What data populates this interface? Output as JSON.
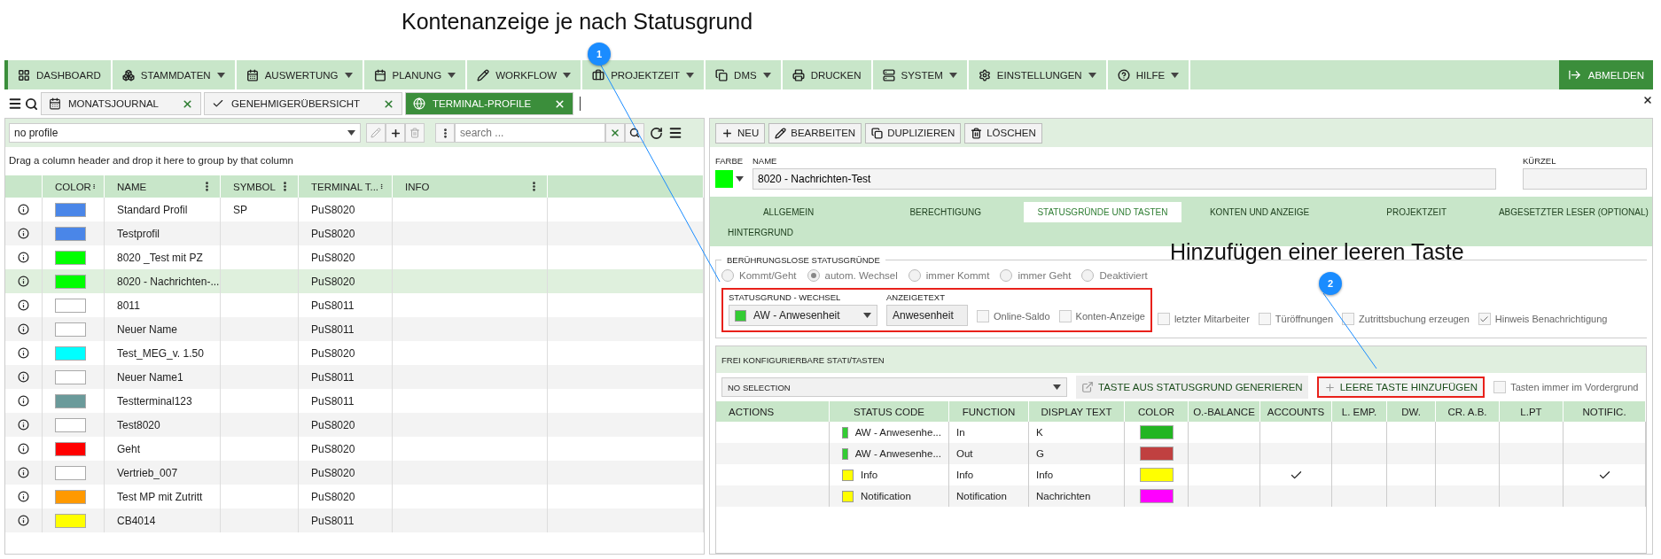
{
  "annotations": [
    {
      "text": "Kontenanzeige je nach Statusgrund"
    },
    {
      "text": "Hinzufügen einer leeren Taste"
    }
  ],
  "callouts": [
    "1",
    "2"
  ],
  "menu": [
    {
      "label": "DASHBOARD",
      "dropdown": false
    },
    {
      "label": "STAMMDATEN",
      "dropdown": true
    },
    {
      "label": "AUSWERTUNG",
      "dropdown": true
    },
    {
      "label": "PLANUNG",
      "dropdown": true
    },
    {
      "label": "WORKFLOW",
      "dropdown": true
    },
    {
      "label": "PROJEKTZEIT",
      "dropdown": true
    },
    {
      "label": "DMS",
      "dropdown": true
    },
    {
      "label": "DRUCKEN",
      "dropdown": false
    },
    {
      "label": "SYSTEM",
      "dropdown": true
    },
    {
      "label": "EINSTELLUNGEN",
      "dropdown": true
    },
    {
      "label": "HILFE",
      "dropdown": true
    }
  ],
  "logout": "ABMELDEN",
  "tabs": [
    {
      "label": "MONATSJOURNAL",
      "selected": false
    },
    {
      "label": "GENEHMIGERÜBERSICHT",
      "selected": false
    },
    {
      "label": "TERMINAL-PROFILE",
      "selected": true
    }
  ],
  "left": {
    "profile": "no profile",
    "search_placeholder": "search ...",
    "group_hint": "Drag a column header and drop it here to group by that column",
    "columns": [
      "COLOR",
      "NAME",
      "SYMBOL",
      "TERMINAL T...",
      "INFO"
    ],
    "rows": [
      {
        "color": "#4a86e8",
        "name": "Standard Profil",
        "symbol": "SP",
        "terminal": "PuS8020",
        "selected": false
      },
      {
        "color": "#4a86e8",
        "name": "Testprofil",
        "terminal": "PuS8020",
        "selected": false
      },
      {
        "color": "#00ff00",
        "name": "8020 _Test mit PZ",
        "terminal": "PuS8020",
        "selected": false
      },
      {
        "color": "#00ff00",
        "name": "8020 - Nachrichten-...",
        "terminal": "PuS8020",
        "selected": true
      },
      {
        "color": "#ffffff",
        "name": "8011",
        "terminal": "PuS8011",
        "selected": false
      },
      {
        "color": "#ffffff",
        "name": "Neuer Name",
        "terminal": "PuS8011",
        "selected": false
      },
      {
        "color": "#00ffff",
        "name": "Test_MEG_v. 1.50",
        "terminal": "PuS8020",
        "selected": false
      },
      {
        "color": "#ffffff",
        "name": "Neuer Name1",
        "terminal": "PuS8011",
        "selected": false
      },
      {
        "color": "#6a9a9a",
        "name": "Testterminal123",
        "terminal": "PuS8011",
        "selected": false
      },
      {
        "color": "#ffffff",
        "name": "Test8020",
        "terminal": "PuS8020",
        "selected": false
      },
      {
        "color": "#ff0000",
        "name": "Geht",
        "terminal": "PuS8020",
        "selected": false
      },
      {
        "color": "#ffffff",
        "name": "Vertrieb_007",
        "terminal": "PuS8020",
        "selected": false
      },
      {
        "color": "#ff9900",
        "name": "Test MP mit Zutritt",
        "terminal": "PuS8020",
        "selected": false
      },
      {
        "color": "#ffff00",
        "name": "CB4014",
        "terminal": "PuS8011",
        "selected": false
      }
    ]
  },
  "right": {
    "toolbar": [
      "NEU",
      "BEARBEITEN",
      "DUPLIZIEREN",
      "LÖSCHEN"
    ],
    "color_label": "FARBE",
    "color": "#00ff00",
    "name_label": "NAME",
    "name": "8020 - Nachrichten-Test",
    "short_label": "KÜRZEL",
    "detail_tabs": [
      {
        "label": "ALLGEMEIN",
        "selected": false
      },
      {
        "label": "BERECHTIGUNG",
        "selected": false
      },
      {
        "label": "STATUSGRÜNDE UND TASTEN",
        "selected": true
      },
      {
        "label": "KONTEN UND ANZEIGE",
        "selected": false
      },
      {
        "label": "PROJEKTZEIT",
        "selected": false
      },
      {
        "label": "ABGESETZTER LESER (OPTIONAL)",
        "selected": false
      },
      {
        "label": "HINTERGRUND",
        "selected": false
      }
    ],
    "contactless": {
      "legend": "BERÜHRUNGSLOSE STATUSGRÜNDE",
      "radios": [
        {
          "label": "Kommt/Geht",
          "selected": false
        },
        {
          "label": "autom. Wechsel",
          "selected": true
        },
        {
          "label": "immer Kommt",
          "selected": false
        },
        {
          "label": "immer Geht",
          "selected": false
        },
        {
          "label": "Deaktiviert",
          "selected": false
        }
      ],
      "reason_label": "STATUSGRUND - WECHSEL",
      "reason": {
        "text": "AW - Anwesenheit",
        "color": "#33cc33"
      },
      "display_label": "ANZEIGETEXT",
      "display": "Anwesenheit",
      "highlighted": true,
      "checks": [
        {
          "label": "Online-Saldo",
          "checked": false
        },
        {
          "label": "Konten-Anzeige",
          "checked": false
        },
        {
          "label": "letzter Mitarbeiter",
          "checked": false
        },
        {
          "label": "Türöffnungen",
          "checked": false
        },
        {
          "label": "Zutrittsbuchung erzeugen",
          "checked": false
        },
        {
          "label": "Hinweis Benachrichtigung",
          "checked": true
        }
      ]
    },
    "keys": {
      "title": "FREI KONFIGURIERBARE STATI/TASTEN",
      "select": "NO SELECTION",
      "generate": "TASTE AUS STATUSGRUND GENERIEREN",
      "add": "LEERE TASTE HINZUFÜGEN",
      "add_highlighted": true,
      "foreground": {
        "label": "Tasten immer im Vordergrund",
        "checked": false
      },
      "columns": [
        "ACTIONS",
        "STATUS CODE",
        "FUNCTION",
        "DISPLAY TEXT",
        "COLOR",
        "O.-BALANCE",
        "ACCOUNTS",
        "L. EMP.",
        "DW.",
        "CR. A.B.",
        "L.PT",
        "NOTIFIC."
      ],
      "rows": [
        {
          "status": {
            "text": "AW - Anwesenhe...",
            "color": "#33cc33"
          },
          "function": "In",
          "display": "K",
          "color": "#22b522",
          "accounts": false,
          "notific": false
        },
        {
          "status": {
            "text": "AW - Anwesenhe...",
            "color": "#33cc33"
          },
          "function": "Out",
          "display": "G",
          "color": "#c04040",
          "accounts": false,
          "notific": false
        },
        {
          "status": {
            "text": "Info",
            "color": "#ffff00"
          },
          "function": "Info",
          "display": "Info",
          "color": "#ffff00",
          "accounts": true,
          "notific": true
        },
        {
          "status": {
            "text": "Notification",
            "color": "#ffff00"
          },
          "function": "Notification",
          "display": "Nachrichten",
          "color": "#ff00ff",
          "accounts": false,
          "notific": false
        }
      ]
    }
  }
}
